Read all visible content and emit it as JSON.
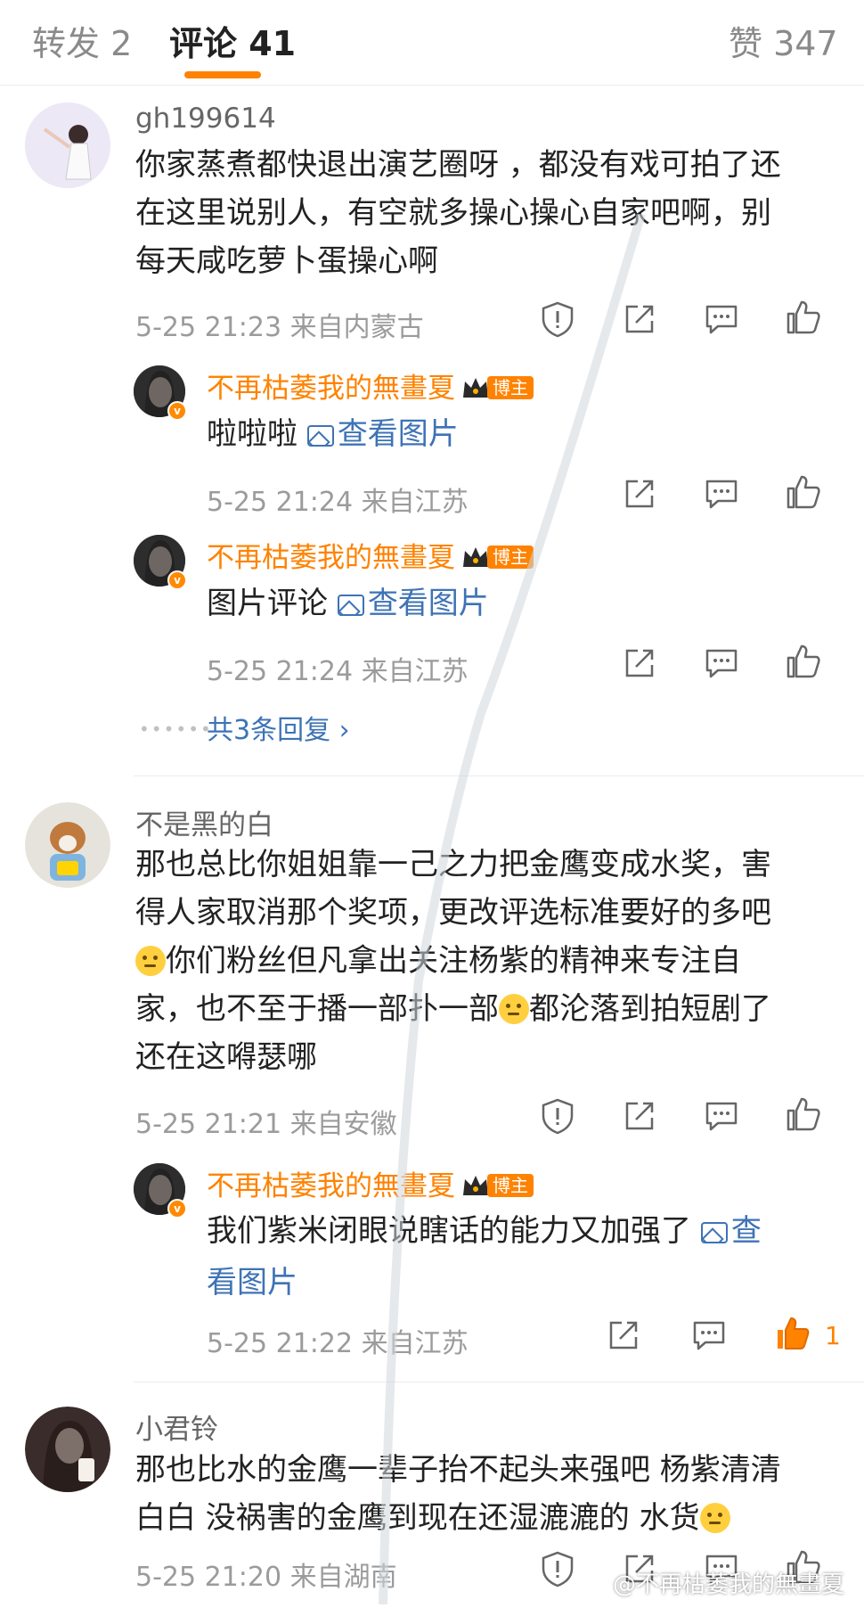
{
  "tabs": {
    "repost": "转发 2",
    "comments": "评论 41",
    "likes": "赞 347"
  },
  "comments": [
    {
      "username": "gh199614",
      "lines": [
        "你家蒸煮都快退出演艺圈呀 ，都没有戏可拍了还",
        "在这里说别人，有空就多操心操心自家吧啊，别",
        "每天咸吃萝卜蛋操心啊"
      ],
      "time": "5-25 21:23",
      "location": "来自内蒙古",
      "replies": [
        {
          "username": "不再枯萎我的無畫夏",
          "badge": "博主",
          "text": "啦啦啦",
          "link": "查看图片",
          "time": "5-25 21:24",
          "location": "来自江苏"
        },
        {
          "username": "不再枯萎我的無畫夏",
          "badge": "博主",
          "text": "图片评论",
          "link": "查看图片",
          "time": "5-25 21:24",
          "location": "来自江苏"
        }
      ],
      "more_replies": "共3条回复 ›"
    },
    {
      "username": "不是黑的白",
      "lines": [
        "那也总比你姐姐靠一己之力把金鹰变成水奖，害",
        "得人家取消那个奖项，更改评选标准要好的多吧",
        "你们粉丝但凡拿出关注杨紫的精神来专注自",
        "家，也不至于播一部扑一部",
        "都沦落到拍短剧了",
        "还在这嘚瑟哪"
      ],
      "time": "5-25 21:21",
      "location": "来自安徽",
      "replies": [
        {
          "username": "不再枯萎我的無畫夏",
          "badge": "博主",
          "text": "我们紫米闭眼说瞎话的能力又加强了 ",
          "link_a": "查",
          "link_b": "看图片",
          "time": "5-25 21:22",
          "location": "来自江苏",
          "like_count": "1"
        }
      ]
    },
    {
      "username": "小君铃",
      "lines": [
        "那也比水的金鹰一辈子抬不起头来强吧 杨紫清清",
        "白白 没祸害的金鹰到现在还湿漉漉的 水货"
      ],
      "time": "5-25 21:20",
      "location": "来自湖南"
    }
  ],
  "watermark": "@不再枯萎我的無畫夏",
  "colors": {
    "accent": "#ff8200",
    "link": "#3e73b5",
    "meta": "#9b9b9b"
  }
}
